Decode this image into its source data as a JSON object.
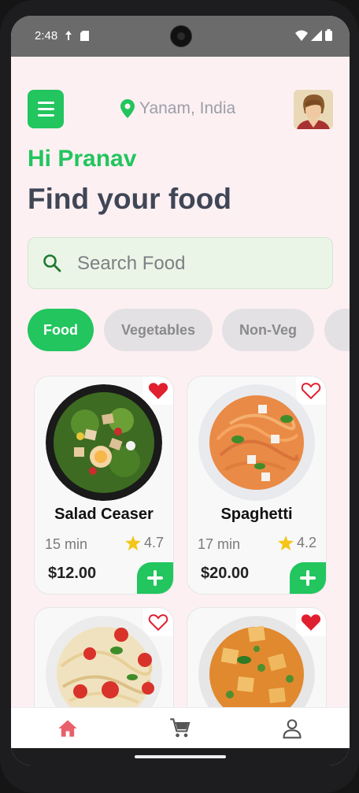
{
  "status_bar": {
    "time": "2:48"
  },
  "header": {
    "location": "Yanam, India"
  },
  "greeting": "Hi Pranav",
  "headline": "Find your food",
  "search": {
    "placeholder": "Search Food",
    "value": ""
  },
  "categories": [
    {
      "label": "Food",
      "active": true
    },
    {
      "label": "Vegetables",
      "active": false
    },
    {
      "label": "Non-Veg",
      "active": false
    }
  ],
  "foods": [
    {
      "name": "Salad Ceaser",
      "time": "15 min",
      "rating": "4.7",
      "price": "$12.00",
      "favorite": true
    },
    {
      "name": "Spaghetti",
      "time": "17 min",
      "rating": "4.2",
      "price": "$20.00",
      "favorite": false
    },
    {
      "name": "",
      "time": "",
      "rating": "",
      "price": "",
      "favorite": false
    },
    {
      "name": "",
      "time": "",
      "rating": "",
      "price": "",
      "favorite": true
    }
  ],
  "colors": {
    "accent": "#22c55e",
    "heart": "#e0202f",
    "star": "#f5c518",
    "nav_active": "#e8606c"
  },
  "nav": {
    "items": [
      "home-icon",
      "cart-icon",
      "profile-icon"
    ],
    "active": "home-icon"
  }
}
